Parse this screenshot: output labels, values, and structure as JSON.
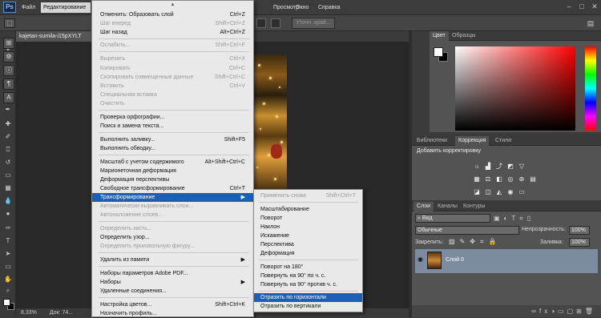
{
  "app": {
    "logo": "Ps"
  },
  "menubar": {
    "items": [
      "Файл",
      "Редактирование",
      "Просмотр",
      "Окно",
      "Справка"
    ],
    "active": "Редактирование"
  },
  "options_bar": {
    "refine_edge_label": "Уточн. край..."
  },
  "document": {
    "tab_title": "kajetan-sumila-i15pXYLT",
    "zoom": "8,33%",
    "doc_info": "Док: 74..."
  },
  "edit_menu": {
    "items": [
      {
        "label": "Отменить: Образовать слой",
        "shortcut": "Ctrl+Z",
        "enabled": true
      },
      {
        "label": "Шаг вперед",
        "shortcut": "Shift+Ctrl+Z",
        "enabled": false
      },
      {
        "label": "Шаг назад",
        "shortcut": "Alt+Ctrl+Z",
        "enabled": true
      },
      {
        "label": "Ослабить...",
        "shortcut": "Shift+Ctrl+F",
        "enabled": false
      },
      {
        "label": "Вырезать",
        "shortcut": "Ctrl+X",
        "enabled": false
      },
      {
        "label": "Копировать",
        "shortcut": "Ctrl+C",
        "enabled": false
      },
      {
        "label": "Скопировать совмещенные данные",
        "shortcut": "Shift+Ctrl+C",
        "enabled": false
      },
      {
        "label": "Вставить",
        "shortcut": "Ctrl+V",
        "enabled": false
      },
      {
        "label": "Специальная вставка",
        "shortcut": "",
        "enabled": false
      },
      {
        "label": "Очистить",
        "shortcut": "",
        "enabled": false
      },
      {
        "label": "Проверка орфографии...",
        "shortcut": "",
        "enabled": true
      },
      {
        "label": "Поиск и замена текста...",
        "shortcut": "",
        "enabled": true
      },
      {
        "label": "Выполнить заливку...",
        "shortcut": "Shift+F5",
        "enabled": true
      },
      {
        "label": "Выполнить обводку...",
        "shortcut": "",
        "enabled": true
      },
      {
        "label": "Масштаб с учетом содержимого",
        "shortcut": "Alt+Shift+Ctrl+C",
        "enabled": true
      },
      {
        "label": "Марионеточная деформация",
        "shortcut": "",
        "enabled": true
      },
      {
        "label": "Деформация перспективы",
        "shortcut": "",
        "enabled": true
      },
      {
        "label": "Свободное трансформирование",
        "shortcut": "Ctrl+T",
        "enabled": true
      },
      {
        "label": "Трансформирование",
        "shortcut": "",
        "enabled": true
      },
      {
        "label": "Автоматически выравнивать слои...",
        "shortcut": "",
        "enabled": false
      },
      {
        "label": "Автоналожение слоев...",
        "shortcut": "",
        "enabled": false
      },
      {
        "label": "Определить кисть...",
        "shortcut": "",
        "enabled": false
      },
      {
        "label": "Определить узор...",
        "shortcut": "",
        "enabled": true
      },
      {
        "label": "Определить произвольную фигуру...",
        "shortcut": "",
        "enabled": false
      },
      {
        "label": "Удалить из памяти",
        "shortcut": "",
        "enabled": true
      },
      {
        "label": "Наборы параметров Adobe PDF...",
        "shortcut": "",
        "enabled": true
      },
      {
        "label": "Наборы",
        "shortcut": "",
        "enabled": true
      },
      {
        "label": "Удаленные соединения...",
        "shortcut": "",
        "enabled": true
      },
      {
        "label": "Настройка цветов...",
        "shortcut": "Shift+Ctrl+K",
        "enabled": true
      },
      {
        "label": "Назначить профиль...",
        "shortcut": "",
        "enabled": true
      }
    ]
  },
  "transform_submenu": {
    "items": [
      {
        "label": "Применить снова",
        "shortcut": "Shift+Ctrl+T",
        "enabled": false
      },
      {
        "label": "Масштабирование",
        "shortcut": "",
        "enabled": true
      },
      {
        "label": "Поворот",
        "shortcut": "",
        "enabled": true
      },
      {
        "label": "Наклон",
        "shortcut": "",
        "enabled": true
      },
      {
        "label": "Искажение",
        "shortcut": "",
        "enabled": true
      },
      {
        "label": "Перспектива",
        "shortcut": "",
        "enabled": true
      },
      {
        "label": "Деформация",
        "shortcut": "",
        "enabled": true
      },
      {
        "label": "Поворот на 180°",
        "shortcut": "",
        "enabled": true
      },
      {
        "label": "Повернуть на 90° по ч. с.",
        "shortcut": "",
        "enabled": true
      },
      {
        "label": "Повернуть на 90° против ч. с.",
        "shortcut": "",
        "enabled": true
      },
      {
        "label": "Отразить по горизонтали",
        "shortcut": "",
        "enabled": true
      },
      {
        "label": "Отразить по вертикали",
        "shortcut": "",
        "enabled": true
      }
    ]
  },
  "color_panel": {
    "tabs": [
      "Цвет",
      "Образцы"
    ]
  },
  "adjustments_panel": {
    "tabs": [
      "Библиотеки",
      "Коррекция",
      "Стили"
    ],
    "heading": "Добавить корректировку"
  },
  "layers_panel": {
    "tabs": [
      "Слои",
      "Каналы",
      "Контуры"
    ],
    "filter_kind": "Вид",
    "blend_mode": "Обычные",
    "opacity_label": "Непрозрачность:",
    "opacity_value": "100%",
    "lock_label": "Закрепить:",
    "fill_label": "Заливка:",
    "fill_value": "100%",
    "layers": [
      {
        "name": "Слой 0"
      }
    ]
  }
}
